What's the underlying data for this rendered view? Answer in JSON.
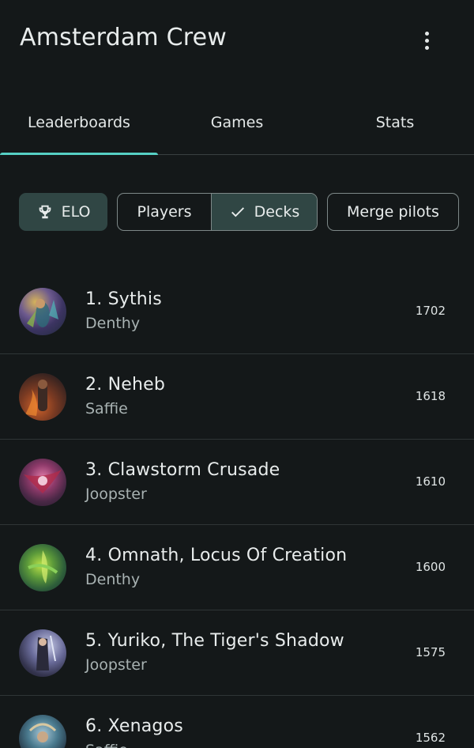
{
  "app_bar": {
    "title": "Amsterdam Crew",
    "menu_icon": "more-vert-icon"
  },
  "tabs": [
    {
      "label": "Leaderboards",
      "selected": true
    },
    {
      "label": "Games",
      "selected": false
    },
    {
      "label": "Stats",
      "selected": false
    }
  ],
  "filters": {
    "elo": {
      "label": "ELO",
      "icon": "trophy-icon",
      "selected": true
    },
    "players": {
      "label": "Players",
      "selected": false
    },
    "decks": {
      "label": "Decks",
      "icon": "check-icon",
      "selected": true
    },
    "merge_pilots": {
      "label": "Merge pilots"
    }
  },
  "leaderboard": [
    {
      "name": "1. Sythis",
      "pilot": "Denthy",
      "rating": "1702"
    },
    {
      "name": "2. Neheb",
      "pilot": "Saffie",
      "rating": "1618"
    },
    {
      "name": "3. Clawstorm Crusade",
      "pilot": "Joopster",
      "rating": "1610"
    },
    {
      "name": "4. Omnath, Locus Of Creation",
      "pilot": "Denthy",
      "rating": "1600"
    },
    {
      "name": "5. Yuriko, The Tiger's Shadow",
      "pilot": "Joopster",
      "rating": "1575"
    },
    {
      "name": "6. Xenagos",
      "pilot": "Saffie",
      "rating": "1562"
    }
  ],
  "colors": {
    "background": "#141819",
    "accent": "#56cfc4",
    "selected_chip": "#304644"
  }
}
